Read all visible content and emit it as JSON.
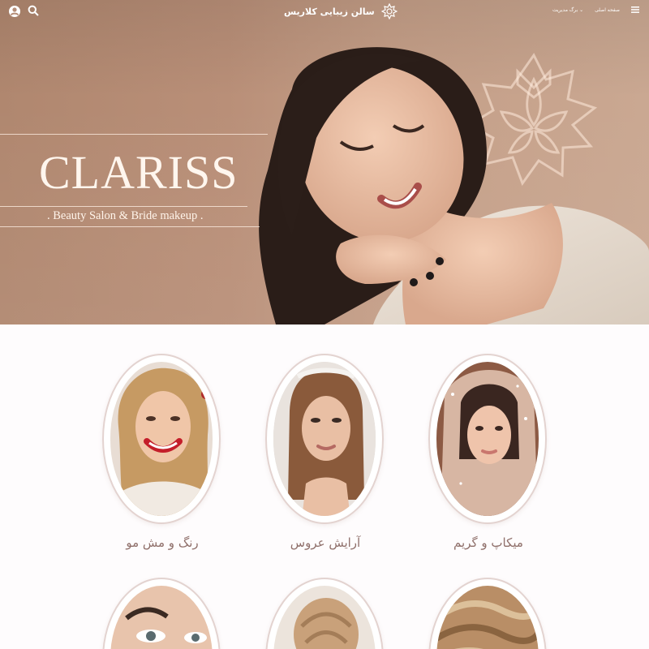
{
  "header": {
    "brand_name": "سالن زیبایی کلاریس",
    "nav": {
      "home": "صفحه اصلی",
      "sample_pages": "برگ مدیریت ⌄"
    }
  },
  "hero": {
    "title": "CLARISS",
    "subtitle": ". Beauty Salon & Bride makeup ."
  },
  "services": [
    {
      "title": "رنگ و مش مو",
      "image": "hair-color-woman-photo"
    },
    {
      "title": "آرایش عروس",
      "image": "bride-makeup-photo"
    },
    {
      "title": "میکاپ و گریم",
      "image": "makeup-woman-photo"
    }
  ],
  "colors": {
    "hero_bg": "#b98f78",
    "accent": "#8f6f6a",
    "frame_border": "#e3d3d0"
  }
}
